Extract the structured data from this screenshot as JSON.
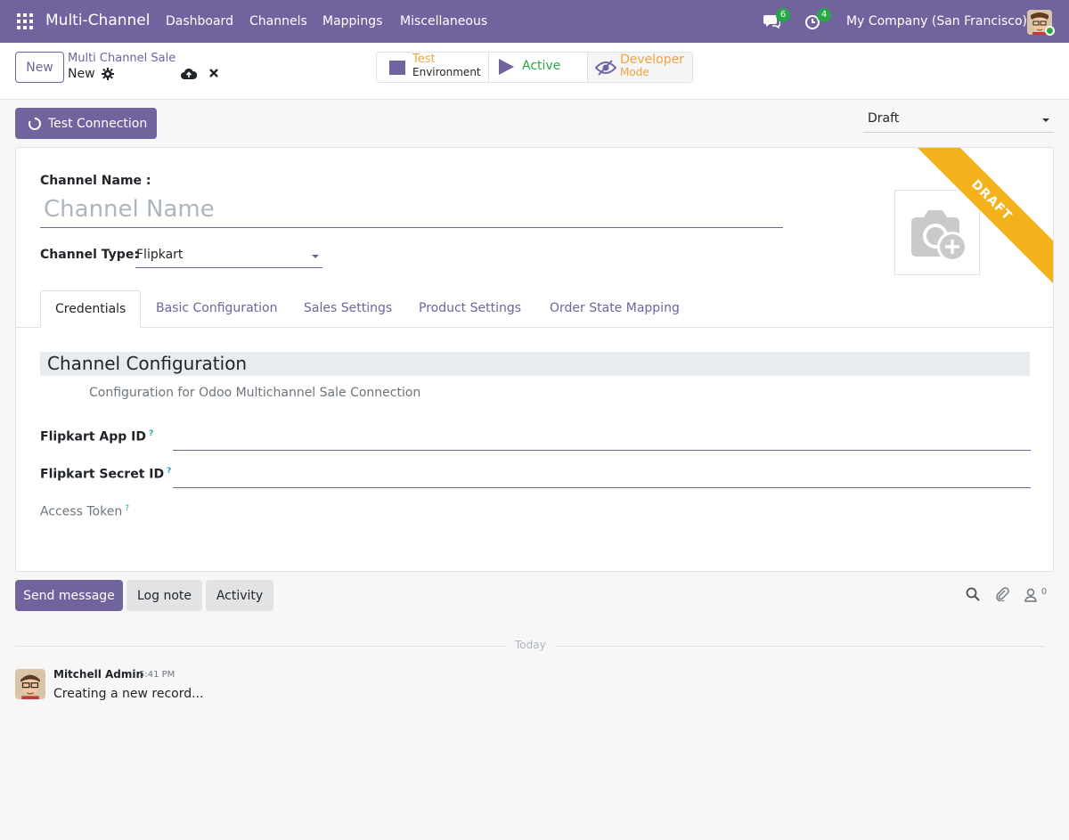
{
  "navbar": {
    "app_name": "Multi-Channel",
    "menu": [
      "Dashboard",
      "Channels",
      "Mappings",
      "Miscellaneous"
    ],
    "messages_count": "6",
    "activities_count": "4",
    "company": "My Company (San Francisco)"
  },
  "control": {
    "new_label": "New",
    "breadcrumb_parent": "Multi Channel Sale",
    "breadcrumb_current": "New",
    "status_buttons": {
      "environment_top": "Test",
      "environment_bottom": "Environment",
      "active": "Active",
      "developer_top": "Developer",
      "developer_bottom": "Mode"
    }
  },
  "statusbar": {
    "test_connection": "Test Connection",
    "state": "Draft"
  },
  "form": {
    "channel_name_label": "Channel Name :",
    "channel_name_placeholder": "Channel Name",
    "channel_type_label": "Channel Type:",
    "channel_type_value": "Flipkart",
    "ribbon": "DRAFT",
    "tabs": [
      "Credentials",
      "Basic Configuration",
      "Sales Settings",
      "Product Settings",
      "Order State Mapping"
    ],
    "section_title": "Channel Configuration",
    "section_subtitle": "Configuration for Odoo Multichannel Sale Connection",
    "fields": {
      "app_id": "Flipkart App ID",
      "secret_id": "Flipkart Secret ID",
      "access_token": "Access Token",
      "help_mark": "?"
    }
  },
  "chatter": {
    "send_message": "Send message",
    "log_note": "Log note",
    "activity": "Activity",
    "followers_count": "0",
    "today": "Today",
    "message": {
      "author": "Mitchell Admin",
      "time": "5:41 PM",
      "body": "Creating a new record..."
    }
  },
  "colors": {
    "brand": "#71639e",
    "success": "#28a745",
    "ribbon": "#f3b21c",
    "developer": "#f0a43a"
  }
}
